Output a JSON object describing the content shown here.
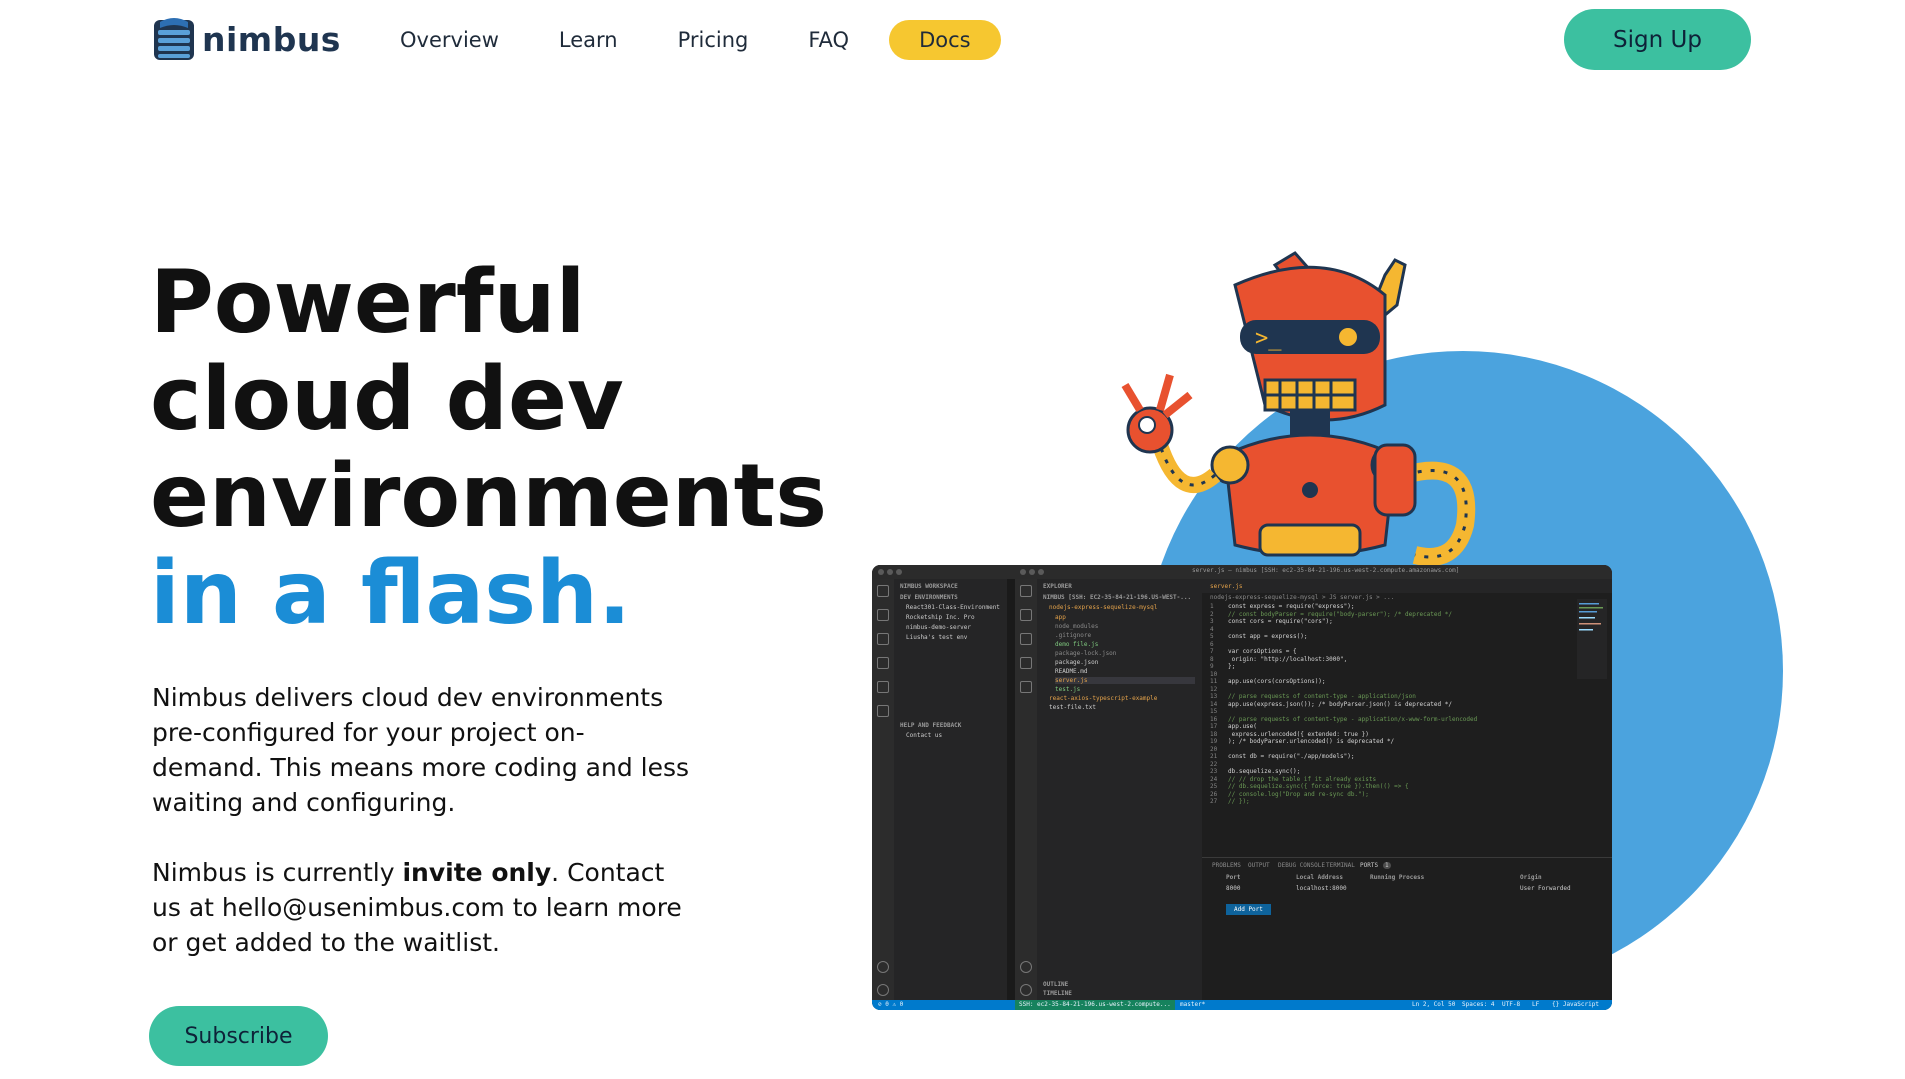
{
  "brand": {
    "name": "nimbus",
    "text_color": "#1f3550",
    "logo_color": "#2d6fb3"
  },
  "nav": {
    "items": [
      {
        "label": "Overview"
      },
      {
        "label": "Learn"
      },
      {
        "label": "Pricing"
      },
      {
        "label": "FAQ"
      },
      {
        "label": "Docs",
        "highlight": true
      }
    ],
    "signup_label": "Sign Up",
    "docs_color": "#f6c730",
    "cta_color": "#3cc0a0"
  },
  "hero": {
    "line1": "Powerful",
    "line2": "cloud dev",
    "line3": "environments",
    "accent_line": "in a flash.",
    "accent_color": "#1b8dd6"
  },
  "description": {
    "paragraph1": "Nimbus delivers cloud dev environments pre-configured for your project on-demand. This means more coding and less waiting and configuring.",
    "p2_prefix": "Nimbus is currently ",
    "p2_bold": "invite only",
    "p2_suffix": ". Contact us at hello@usenimbus.com to learn more or get added to the waitlist."
  },
  "subscribe_label": "Subscribe",
  "illustration": {
    "circle_color": "#4ba3de",
    "robot_colors": [
      "#e8512f",
      "#f5b731",
      "#1f3550"
    ]
  },
  "editor": {
    "title": "server.js — nimbus [SSH: ec2-35-84-21-196.us-west-2.compute.amazonaws.com]",
    "workspace_header": "NIMBUS WORKSPACE",
    "dev_env_header": "DEV ENVIRONMENTS",
    "environments": [
      "React301-Class-Environment",
      "Rocketship Inc. Pro",
      "nimbus-demo-server",
      "Liusha's test env"
    ],
    "help_header": "HELP AND FEEDBACK",
    "help_items": [
      "Contact us"
    ],
    "explorer_header": "EXPLORER",
    "explorer_root": "NIMBUS [SSH: EC2-35-84-21-196.US-WEST-...",
    "project": "nodejs-express-sequelize-mysql",
    "files": [
      "app",
      "node_modules",
      ".gitignore",
      "demo file.js",
      "package-lock.json",
      "package.json",
      "README.md",
      "server.js",
      "test.js",
      "react-axios-typescript-example",
      "test-file.txt"
    ],
    "outline_label": "OUTLINE",
    "timeline_label": "TIMELINE",
    "tab": "server.js",
    "breadcrumb": "nodejs-express-sequelize-mysql > JS server.js > ...",
    "code": [
      "const express = require(\"express\");",
      "// const bodyParser = require(\"body-parser\"); /* deprecated */",
      "const cors = require(\"cors\");",
      "",
      "const app = express();",
      "",
      "var corsOptions = {",
      "  origin: \"http://localhost:3000\",",
      "};",
      "",
      "app.use(cors(corsOptions));",
      "",
      "// parse requests of content-type - application/json",
      "app.use(express.json()); /* bodyParser.json() is deprecated */",
      "",
      "// parse requests of content-type - application/x-www-form-urlencoded",
      "app.use(",
      "  express.urlencoded({ extended: true })",
      "); /* bodyParser.urlencoded() is deprecated */",
      "",
      "const db = require(\"./app/models\");",
      "",
      "db.sequelize.sync();",
      "// // drop the table if it already exists",
      "// db.sequelize.sync({ force: true }).then(() => {",
      "//   console.log(\"Drop and re-sync db.\");",
      "// });"
    ],
    "panel_tabs": [
      "PROBLEMS",
      "OUTPUT",
      "DEBUG CONSOLE",
      "TERMINAL",
      "PORTS"
    ],
    "ports_count": "1",
    "ports_headers": [
      "Port",
      "Local Address",
      "Running Process",
      "Origin"
    ],
    "port_row": [
      "8000",
      "localhost:8000",
      "",
      "User Forwarded"
    ],
    "add_port": "Add Port",
    "status_remote": "SSH: ec2-35-84-21-196.us-west-2.compute...",
    "status_left": "⊘ 0 ⚠ 0",
    "status_branch": "master*",
    "status_items": [
      "Ln 2, Col 50",
      "Spaces: 4",
      "UTF-8",
      "LF",
      "{} JavaScript"
    ]
  }
}
